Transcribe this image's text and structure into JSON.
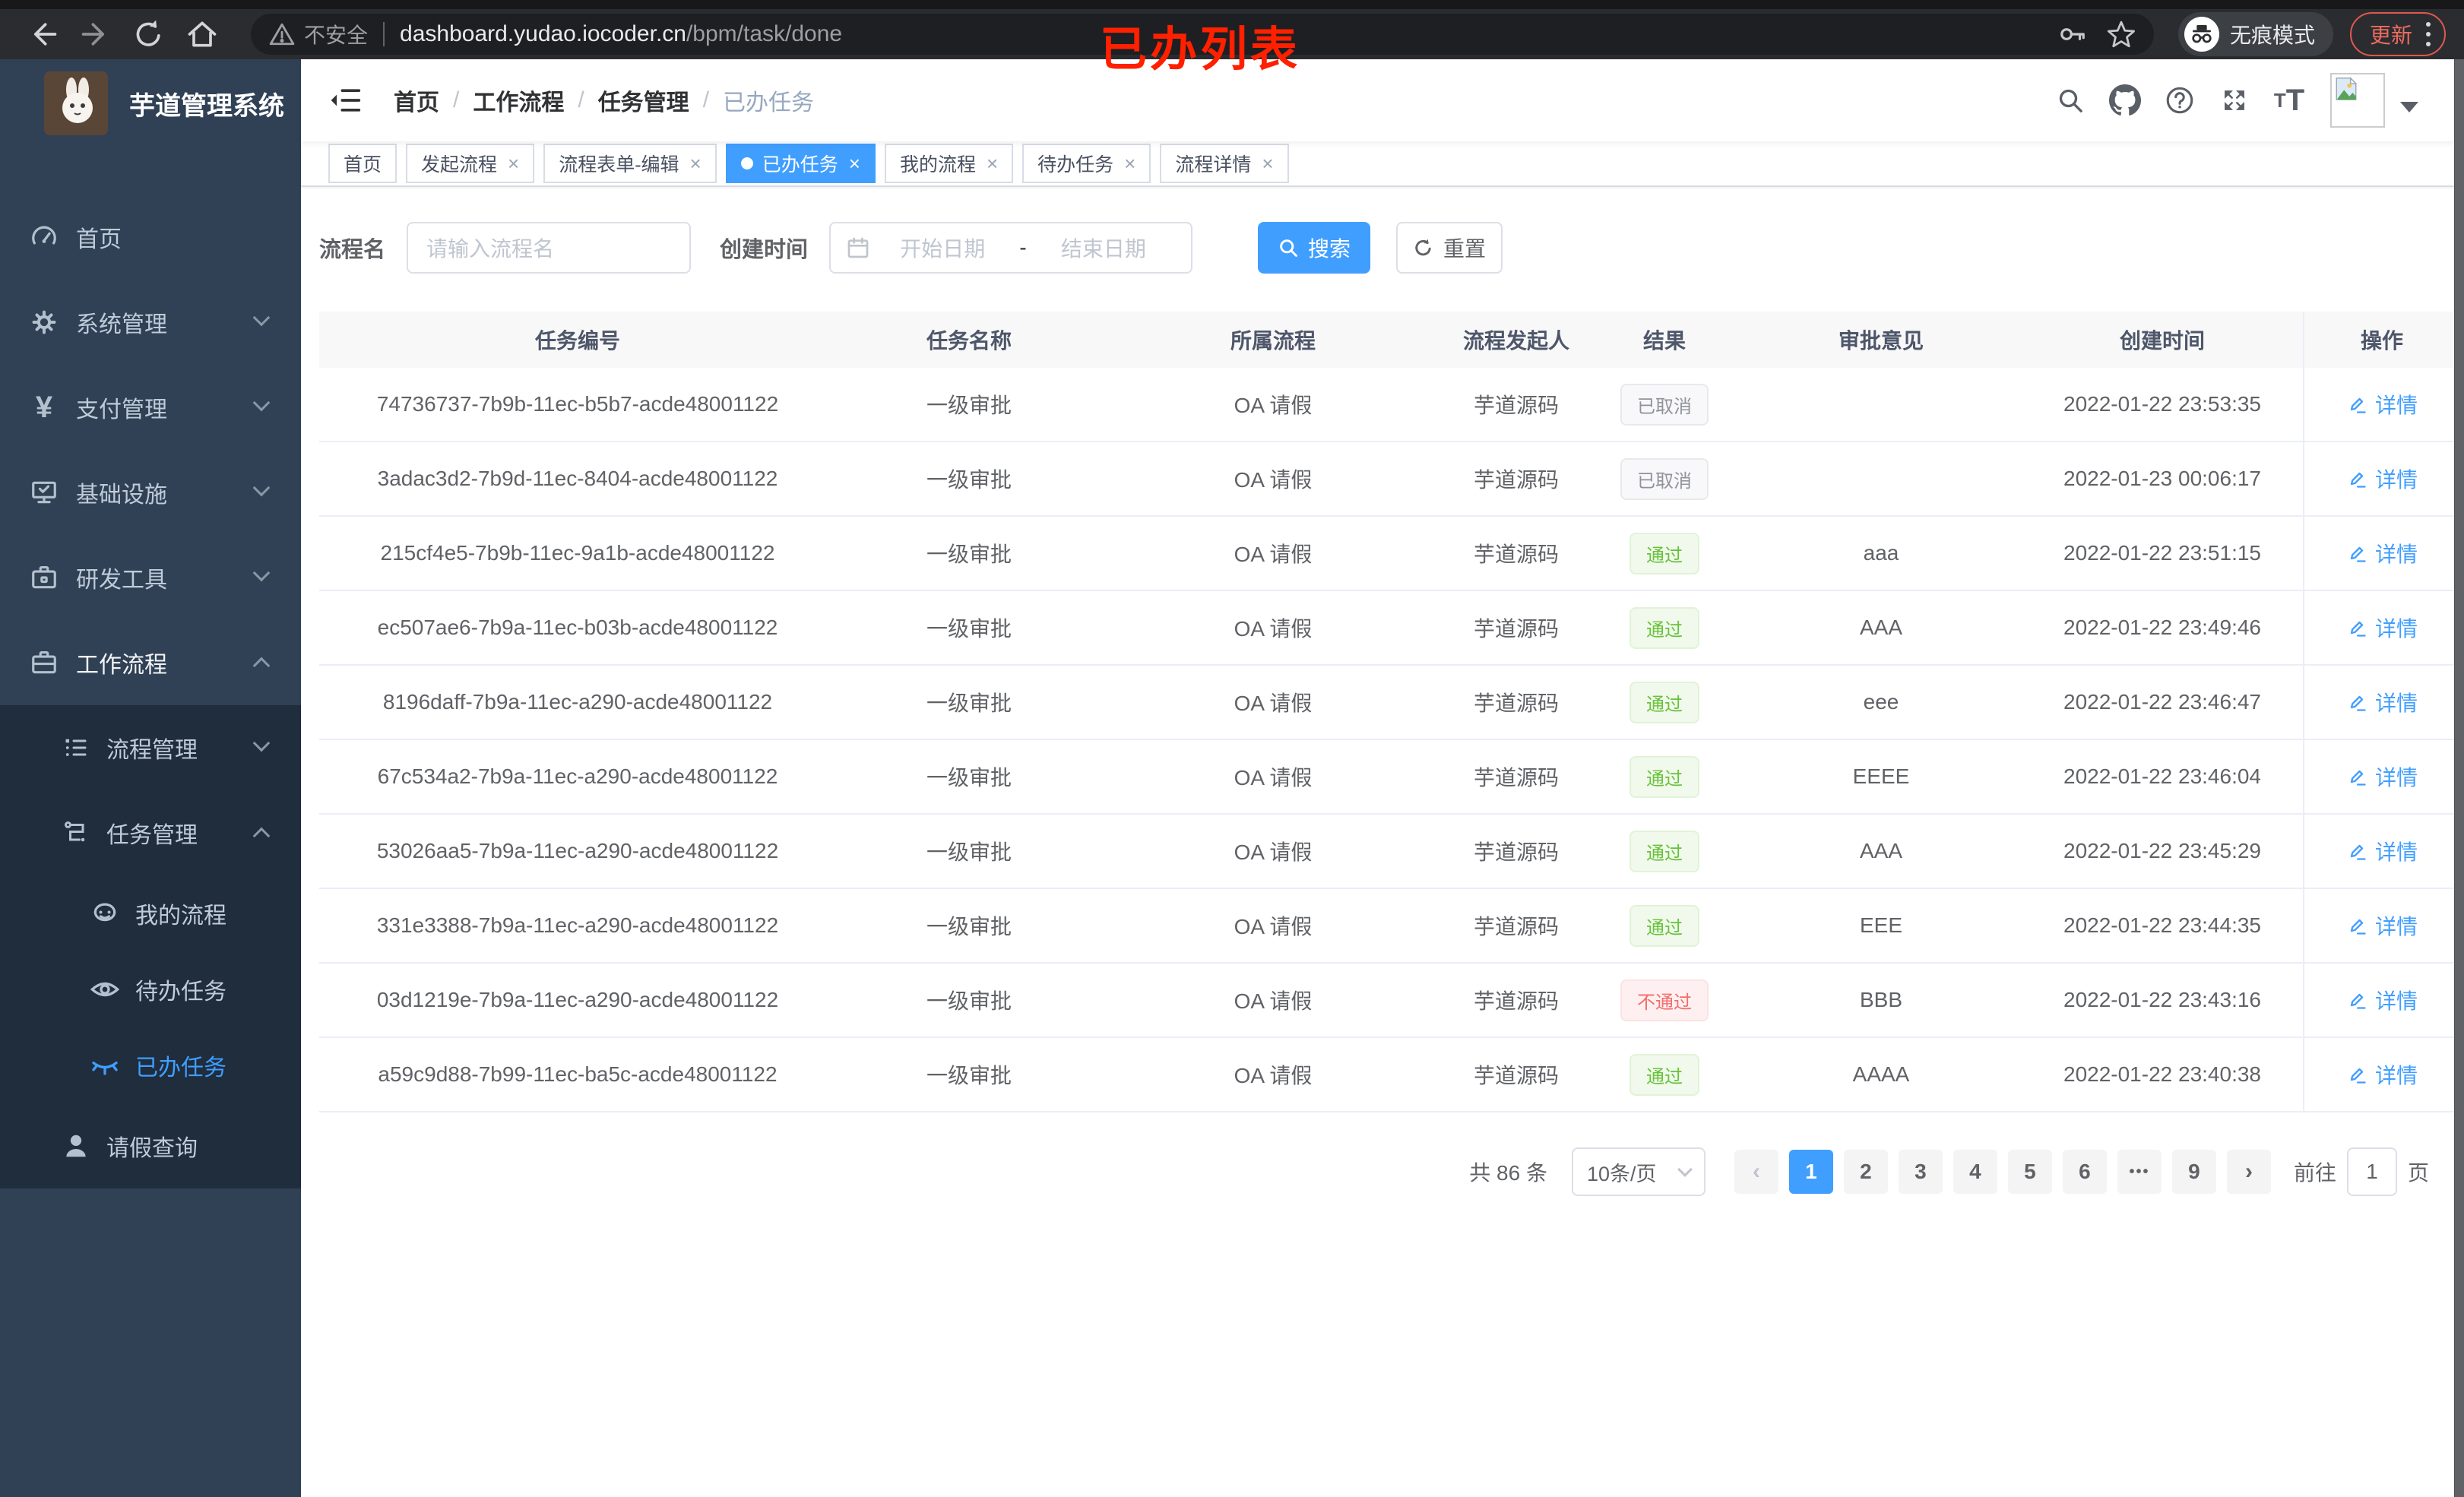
{
  "colors": {
    "accent": "#409eff",
    "success": "#67c23a",
    "danger": "#f56c6c",
    "info": "#909399",
    "sidebar_bg": "#304156",
    "submenu_bg": "#1f2d3d"
  },
  "browser": {
    "security_label": "不安全",
    "url_domain": "dashboard.yudao.iocoder.cn",
    "url_path": "/bpm/task/done",
    "incognito_label": "无痕模式",
    "update_label": "更新"
  },
  "annotation": {
    "text": "已办列表"
  },
  "sidebar": {
    "logo_title": "芋道管理系统",
    "menu": [
      {
        "label": "首页"
      },
      {
        "label": "系统管理"
      },
      {
        "label": "支付管理"
      },
      {
        "label": "基础设施"
      },
      {
        "label": "研发工具"
      },
      {
        "label": "工作流程"
      },
      {
        "label": "流程管理"
      },
      {
        "label": "任务管理"
      },
      {
        "label": "我的流程"
      },
      {
        "label": "待办任务"
      },
      {
        "label": "已办任务"
      },
      {
        "label": "请假查询"
      }
    ]
  },
  "breadcrumb": {
    "items": [
      "首页",
      "工作流程",
      "任务管理",
      "已办任务"
    ]
  },
  "tabs": [
    {
      "label": "首页",
      "closable": false,
      "active": false
    },
    {
      "label": "发起流程",
      "closable": true,
      "active": false
    },
    {
      "label": "流程表单-编辑",
      "closable": true,
      "active": false
    },
    {
      "label": "已办任务",
      "closable": true,
      "active": true
    },
    {
      "label": "我的流程",
      "closable": true,
      "active": false
    },
    {
      "label": "待办任务",
      "closable": true,
      "active": false
    },
    {
      "label": "流程详情",
      "closable": true,
      "active": false
    }
  ],
  "search": {
    "name_label": "流程名",
    "name_placeholder": "请输入流程名",
    "time_label": "创建时间",
    "start_placeholder": "开始日期",
    "range_separator": "-",
    "end_placeholder": "结束日期",
    "search_button": "搜索",
    "reset_button": "重置"
  },
  "table": {
    "columns": [
      "任务编号",
      "任务名称",
      "所属流程",
      "流程发起人",
      "结果",
      "审批意见",
      "创建时间",
      "操作"
    ],
    "action_label": "详情",
    "rows": [
      {
        "id": "74736737-7b9b-11ec-b5b7-acde48001122",
        "name": "一级审批",
        "flow": "OA 请假",
        "starter": "芋道源码",
        "result": {
          "text": "已取消",
          "type": "info"
        },
        "comment": "",
        "time": "2022-01-22 23:53:35"
      },
      {
        "id": "3adac3d2-7b9d-11ec-8404-acde48001122",
        "name": "一级审批",
        "flow": "OA 请假",
        "starter": "芋道源码",
        "result": {
          "text": "已取消",
          "type": "info"
        },
        "comment": "",
        "time": "2022-01-23 00:06:17"
      },
      {
        "id": "215cf4e5-7b9b-11ec-9a1b-acde48001122",
        "name": "一级审批",
        "flow": "OA 请假",
        "starter": "芋道源码",
        "result": {
          "text": "通过",
          "type": "success"
        },
        "comment": "aaa",
        "time": "2022-01-22 23:51:15"
      },
      {
        "id": "ec507ae6-7b9a-11ec-b03b-acde48001122",
        "name": "一级审批",
        "flow": "OA 请假",
        "starter": "芋道源码",
        "result": {
          "text": "通过",
          "type": "success"
        },
        "comment": "AAA",
        "time": "2022-01-22 23:49:46"
      },
      {
        "id": "8196daff-7b9a-11ec-a290-acde48001122",
        "name": "一级审批",
        "flow": "OA 请假",
        "starter": "芋道源码",
        "result": {
          "text": "通过",
          "type": "success"
        },
        "comment": "eee",
        "time": "2022-01-22 23:46:47"
      },
      {
        "id": "67c534a2-7b9a-11ec-a290-acde48001122",
        "name": "一级审批",
        "flow": "OA 请假",
        "starter": "芋道源码",
        "result": {
          "text": "通过",
          "type": "success"
        },
        "comment": "EEEE",
        "time": "2022-01-22 23:46:04"
      },
      {
        "id": "53026aa5-7b9a-11ec-a290-acde48001122",
        "name": "一级审批",
        "flow": "OA 请假",
        "starter": "芋道源码",
        "result": {
          "text": "通过",
          "type": "success"
        },
        "comment": "AAA",
        "time": "2022-01-22 23:45:29"
      },
      {
        "id": "331e3388-7b9a-11ec-a290-acde48001122",
        "name": "一级审批",
        "flow": "OA 请假",
        "starter": "芋道源码",
        "result": {
          "text": "通过",
          "type": "success"
        },
        "comment": "EEE",
        "time": "2022-01-22 23:44:35"
      },
      {
        "id": "03d1219e-7b9a-11ec-a290-acde48001122",
        "name": "一级审批",
        "flow": "OA 请假",
        "starter": "芋道源码",
        "result": {
          "text": "不通过",
          "type": "danger"
        },
        "comment": "BBB",
        "time": "2022-01-22 23:43:16"
      },
      {
        "id": "a59c9d88-7b99-11ec-ba5c-acde48001122",
        "name": "一级审批",
        "flow": "OA 请假",
        "starter": "芋道源码",
        "result": {
          "text": "通过",
          "type": "success"
        },
        "comment": "AAAA",
        "time": "2022-01-22 23:40:38"
      }
    ]
  },
  "pagination": {
    "total": "共 86 条",
    "page_size": "10条/页",
    "pages": [
      "1",
      "2",
      "3",
      "4",
      "5",
      "6",
      "•••",
      "9"
    ],
    "goto_label": "前往",
    "goto_value": "1",
    "page_unit": "页"
  }
}
